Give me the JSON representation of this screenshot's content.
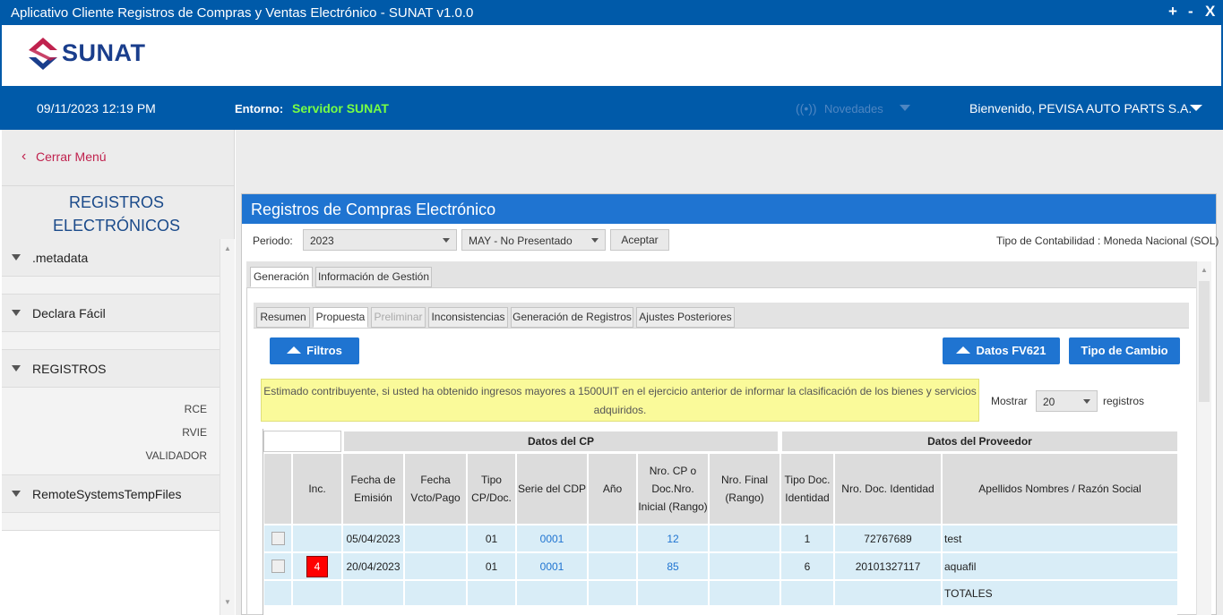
{
  "window": {
    "title": "Aplicativo Cliente Registros de Compras y Ventas Electrónico - SUNAT v1.0.0",
    "controls": [
      "+",
      "-",
      "X"
    ]
  },
  "brand": {
    "logo_text": "SUNAT"
  },
  "header": {
    "datetime": "09/11/2023 12:19 PM",
    "env_label": "Entorno:",
    "env_value": "Servidor SUNAT",
    "novedades": "Novedades",
    "welcome": "Bienvenido, PEVISA AUTO PARTS S.A."
  },
  "sidebar": {
    "close_menu": "Cerrar Menú",
    "title_line1": "REGISTROS",
    "title_line2": "ELECTRÓNICOS",
    "sections": [
      {
        "name": ".metadata",
        "items": []
      },
      {
        "name": "Declara Fácil",
        "items": []
      },
      {
        "name": "REGISTROS",
        "items": [
          "RCE",
          "RVIE",
          "VALIDADOR"
        ]
      },
      {
        "name": "RemoteSystemsTempFiles",
        "items": []
      }
    ]
  },
  "panel": {
    "title": "Registros de Compras Electrónico",
    "periodo_label": "Periodo:",
    "year": "2023",
    "month": "MAY - No Presentado",
    "accept": "Aceptar",
    "accounting_type": "Tipo de Contabilidad : Moneda Nacional (SOL)"
  },
  "tabs_main": [
    "Generación",
    "Información de Gestión"
  ],
  "tabs_sub": [
    "Resumen",
    "Propuesta",
    "Preliminar",
    "Inconsistencias",
    "Generación de Registros",
    "Ajustes Posteriores"
  ],
  "buttons": {
    "filtros": "Filtros",
    "datos_fv": "Datos FV621",
    "tipo_cambio": "Tipo de Cambio"
  },
  "notice": {
    "line1": "Estimado contribuyente, si usted ha obtenido ingresos mayores a 1500UIT en el ejercicio anterior de informar la clasificación de los bienes y servicios",
    "line2": "adquiridos."
  },
  "show": {
    "label": "Mostrar",
    "value": "20",
    "suffix": "registros"
  },
  "table": {
    "group1": "Datos del CP",
    "group2": "Datos del Proveedor",
    "headers": {
      "inc": "Inc.",
      "fecha_emision": "Fecha de Emisión",
      "fecha_vcto": "Fecha Vcto/Pago",
      "tipo_cp": "Tipo CP/Doc.",
      "serie": "Serie del CDP",
      "anio": "Año",
      "nro_cp": "Nro. CP o Doc.Nro. Inicial (Rango)",
      "nro_final": "Nro. Final (Rango)",
      "tipo_doc": "Tipo Doc. Identidad",
      "nro_doc": "Nro. Doc. Identidad",
      "razon": "Apellidos Nombres / Razón Social"
    },
    "rows": [
      {
        "inc": "",
        "fecha_emision": "05/04/2023",
        "fecha_vcto": "",
        "tipo_cp": "01",
        "serie": "0001",
        "anio": "",
        "nro_cp": "12",
        "nro_final": "",
        "tipo_doc": "1",
        "nro_doc": "72767689",
        "razon": "test"
      },
      {
        "inc": "4",
        "fecha_emision": "20/04/2023",
        "fecha_vcto": "",
        "tipo_cp": "01",
        "serie": "0001",
        "anio": "",
        "nro_cp": "85",
        "nro_final": "",
        "tipo_doc": "6",
        "nro_doc": "20101327117",
        "razon": "aquafil"
      }
    ],
    "totals_label": "TOTALES"
  }
}
